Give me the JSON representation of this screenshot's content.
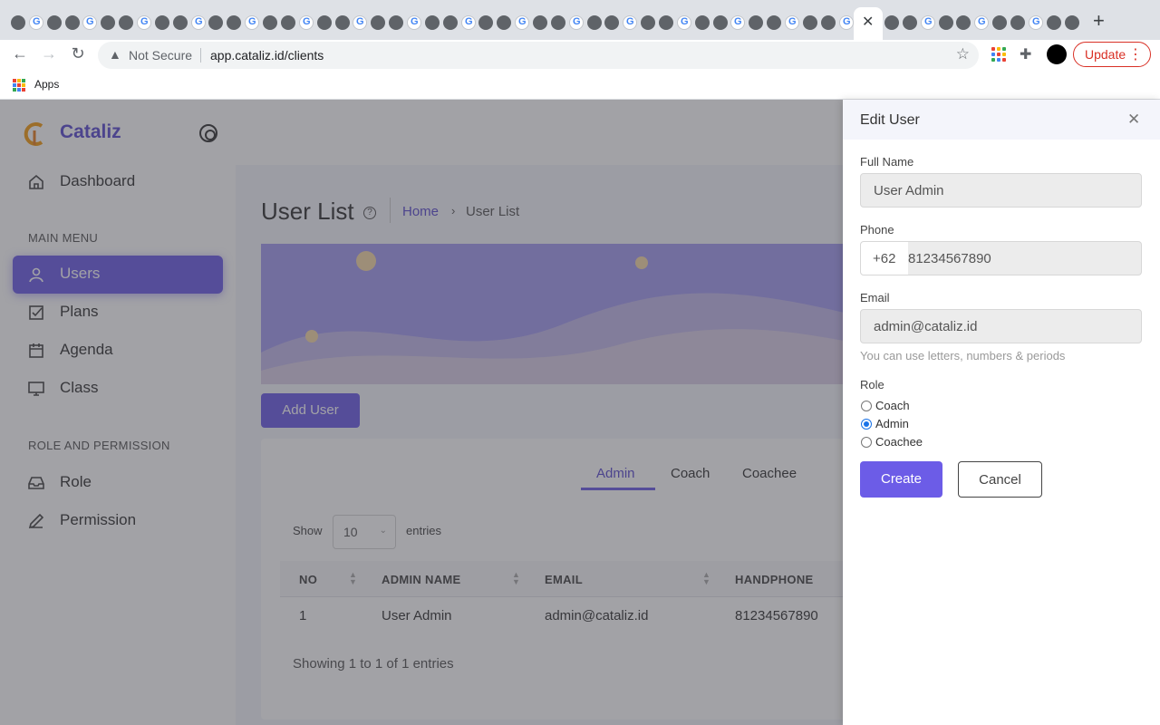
{
  "browser": {
    "tab_count_icons": 58,
    "new_tab_label": "+",
    "security_label": "Not Secure",
    "url": "app.cataliz.id/clients",
    "update_label": "Update",
    "bookmarks": {
      "apps_label": "Apps"
    }
  },
  "sidebar": {
    "brand": "Cataliz",
    "items_main": [
      {
        "label": "Dashboard",
        "icon": "home-icon"
      }
    ],
    "main_menu_label": "MAIN MENU",
    "main_items": [
      {
        "label": "Users",
        "icon": "user-icon",
        "active": true
      },
      {
        "label": "Plans",
        "icon": "checkbox-icon"
      },
      {
        "label": "Agenda",
        "icon": "calendar-icon"
      },
      {
        "label": "Class",
        "icon": "monitor-icon"
      }
    ],
    "role_section_label": "ROLE AND PERMISSION",
    "role_items": [
      {
        "label": "Role",
        "icon": "inbox-icon"
      },
      {
        "label": "Permission",
        "icon": "pen-icon"
      }
    ]
  },
  "main": {
    "title": "User List",
    "breadcrumb": {
      "home": "Home",
      "current": "User List",
      "separator": "›"
    },
    "add_user_label": "Add User",
    "tabs": [
      "Admin",
      "Coach",
      "Coachee"
    ],
    "active_tab": "Admin",
    "show_label": "Show",
    "page_size": "10",
    "entries_label": "entries",
    "table": {
      "columns": [
        "NO",
        "ADMIN NAME",
        "EMAIL",
        "HANDPHONE"
      ],
      "rows": [
        [
          "1",
          "User Admin",
          "admin@cataliz.id",
          "81234567890"
        ]
      ]
    },
    "showing_text": "Showing 1 to 1 of 1 entries"
  },
  "drawer": {
    "title": "Edit User",
    "full_name_label": "Full Name",
    "full_name_value": "User Admin",
    "phone_label": "Phone",
    "phone_prefix": "+62",
    "phone_value": "81234567890",
    "email_label": "Email",
    "email_value": "admin@cataliz.id",
    "email_hint": "You can use letters, numbers & periods",
    "role_label": "Role",
    "role_options": [
      "Coach",
      "Admin",
      "Coachee"
    ],
    "selected_role": "Admin",
    "create_label": "Create",
    "cancel_label": "Cancel"
  },
  "colors": {
    "accent": "#6c5ce7",
    "brand_text": "#5b4bcf",
    "danger": "#d93025"
  }
}
